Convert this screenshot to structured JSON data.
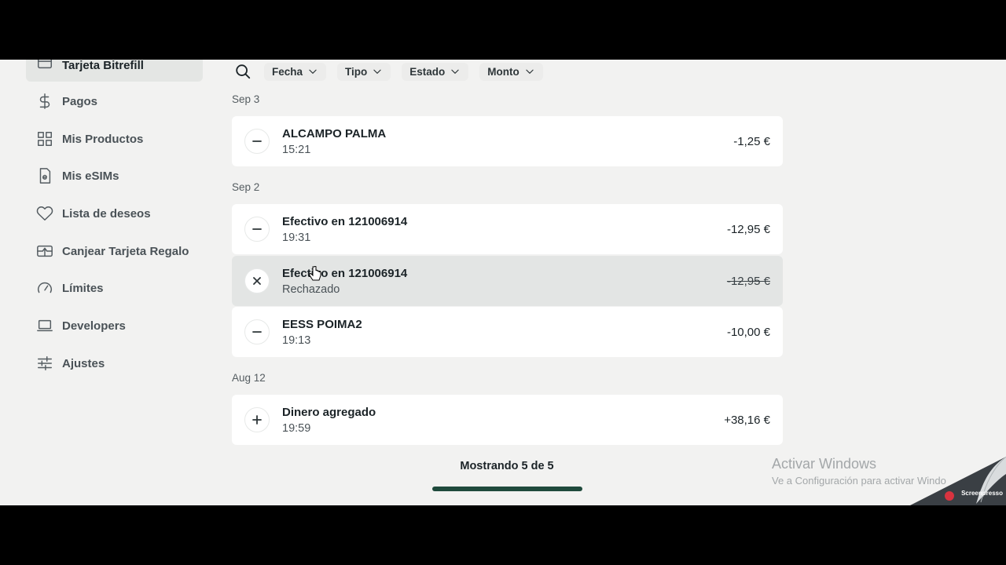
{
  "sidebar": {
    "items": [
      {
        "label": "Tarjeta Bitrefill",
        "icon": "card-icon"
      },
      {
        "label": "Pagos",
        "icon": "dollar-icon"
      },
      {
        "label": "Mis Productos",
        "icon": "grid-icon"
      },
      {
        "label": "Mis eSIMs",
        "icon": "esim-icon"
      },
      {
        "label": "Lista de deseos",
        "icon": "heart-icon"
      },
      {
        "label": "Canjear Tarjeta Regalo",
        "icon": "gift-card-icon"
      },
      {
        "label": "Límites",
        "icon": "gauge-icon"
      },
      {
        "label": "Developers",
        "icon": "laptop-icon"
      },
      {
        "label": "Ajustes",
        "icon": "sliders-icon"
      }
    ]
  },
  "filters": {
    "search_icon": "search-icon",
    "items": [
      "Fecha",
      "Tipo",
      "Estado",
      "Monto"
    ]
  },
  "groups": [
    {
      "date": "Sep 3"
    },
    {
      "date": "Sep 2"
    },
    {
      "date": "Aug 12"
    }
  ],
  "transactions": [
    {
      "name": "ALCAMPO PALMA",
      "sub": "15:21",
      "amount": "-1,25 €",
      "icon": "minus-icon"
    },
    {
      "name": "Efectivo en 121006914",
      "sub": "19:31",
      "amount": "-12,95 €",
      "icon": "minus-icon"
    },
    {
      "name": "Efectivo en 121006914",
      "sub": "Rechazado",
      "amount": "-12,95 €",
      "icon": "close-icon"
    },
    {
      "name": "EESS POIMA2",
      "sub": "19:13",
      "amount": "-10,00 €",
      "icon": "minus-icon"
    },
    {
      "name": "Dinero agregado",
      "sub": "19:59",
      "amount": "+38,16 €",
      "icon": "plus-icon"
    }
  ],
  "footer": {
    "showing": "Mostrando 5 de 5"
  },
  "watermark": {
    "title": "Activar Windows",
    "subtitle": "Ve a Configuración para activar Windo",
    "brand": "Screenpresso"
  },
  "colors": {
    "accent": "#1f4a3c",
    "background": "#f2f2f1"
  }
}
